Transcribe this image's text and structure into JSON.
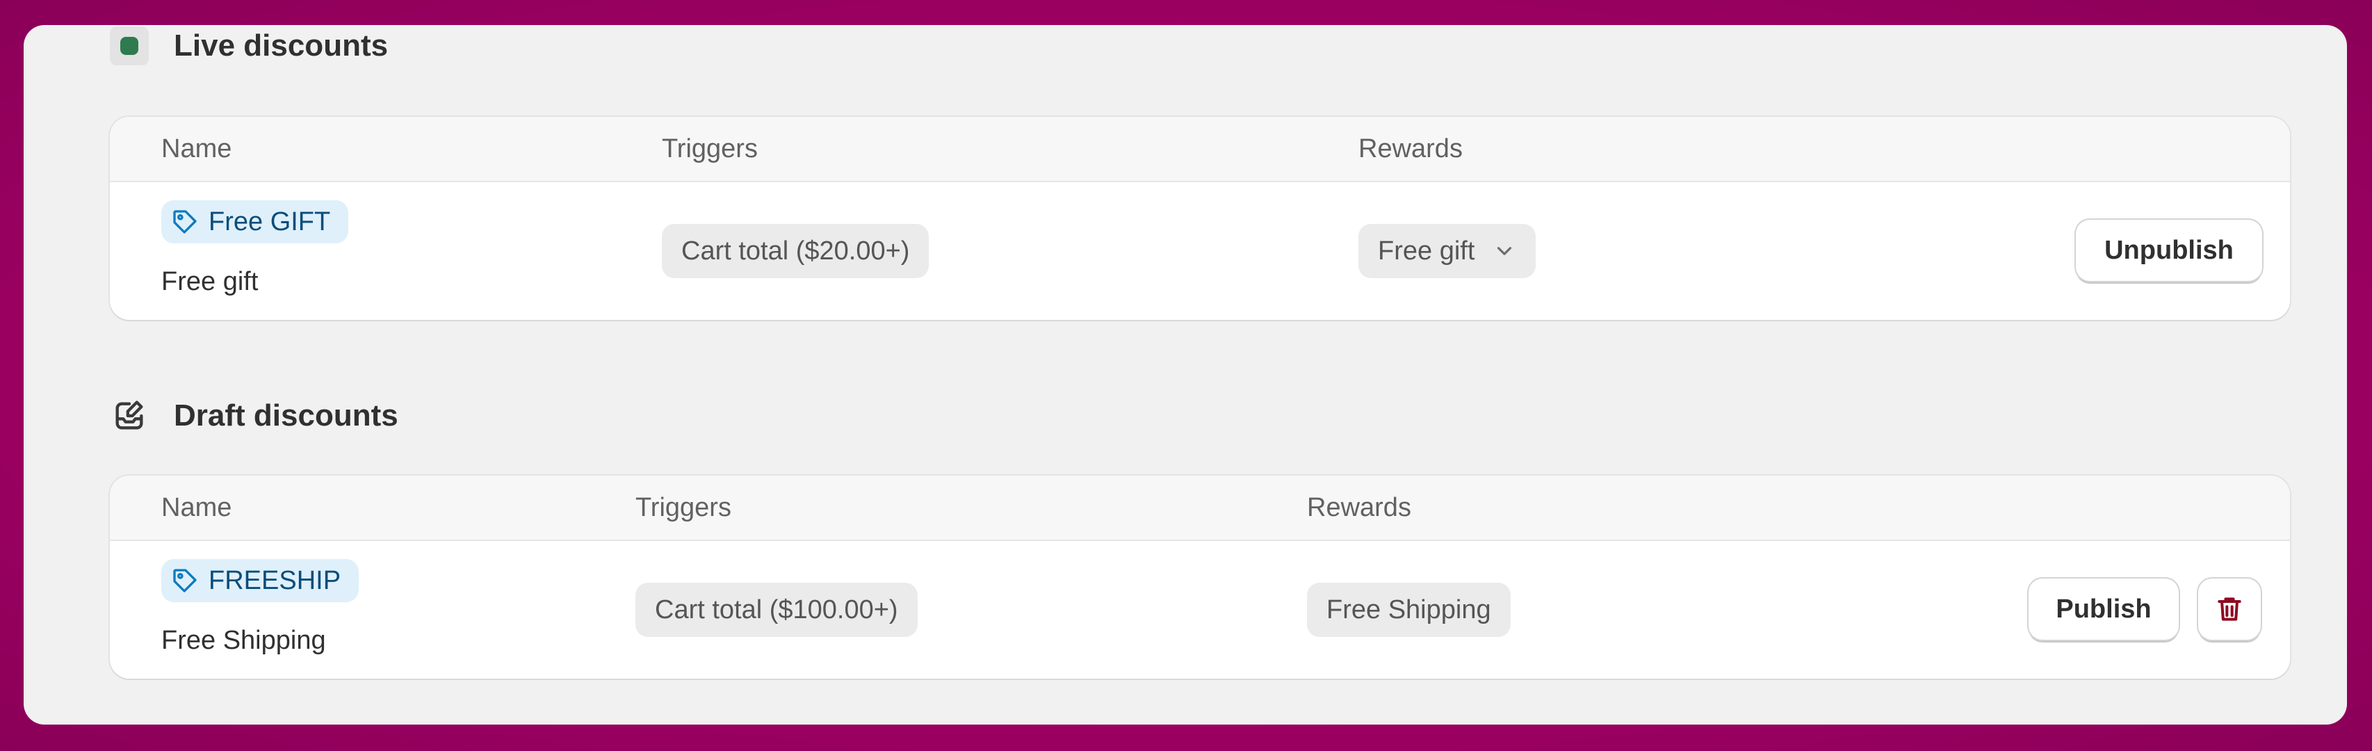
{
  "live": {
    "title": "Live discounts",
    "columns": {
      "name": "Name",
      "triggers": "Triggers",
      "rewards": "Rewards"
    },
    "row": {
      "tag": "Free GIFT",
      "subtitle": "Free gift",
      "trigger": "Cart total ($20.00+)",
      "reward": "Free gift",
      "action": "Unpublish"
    }
  },
  "draft": {
    "title": "Draft discounts",
    "columns": {
      "name": "Name",
      "triggers": "Triggers",
      "rewards": "Rewards"
    },
    "row": {
      "tag": "FREESHIP",
      "subtitle": "Free Shipping",
      "trigger": "Cart total ($100.00+)",
      "reward": "Free Shipping",
      "action": "Publish"
    }
  },
  "icons": {
    "live_status": "status-dot-icon",
    "draft_status": "draft-edit-icon",
    "tag": "tag-icon",
    "reward_dropdown": "chevron-down-icon",
    "delete": "trash-icon"
  },
  "colors": {
    "background": "#9a0060",
    "panel": "#f1f1f1",
    "live_dot": "#2f7a4f",
    "tag_bg": "#dff0fb",
    "tag_text": "#0b4d7a",
    "delete_icon": "#8e0b21"
  }
}
